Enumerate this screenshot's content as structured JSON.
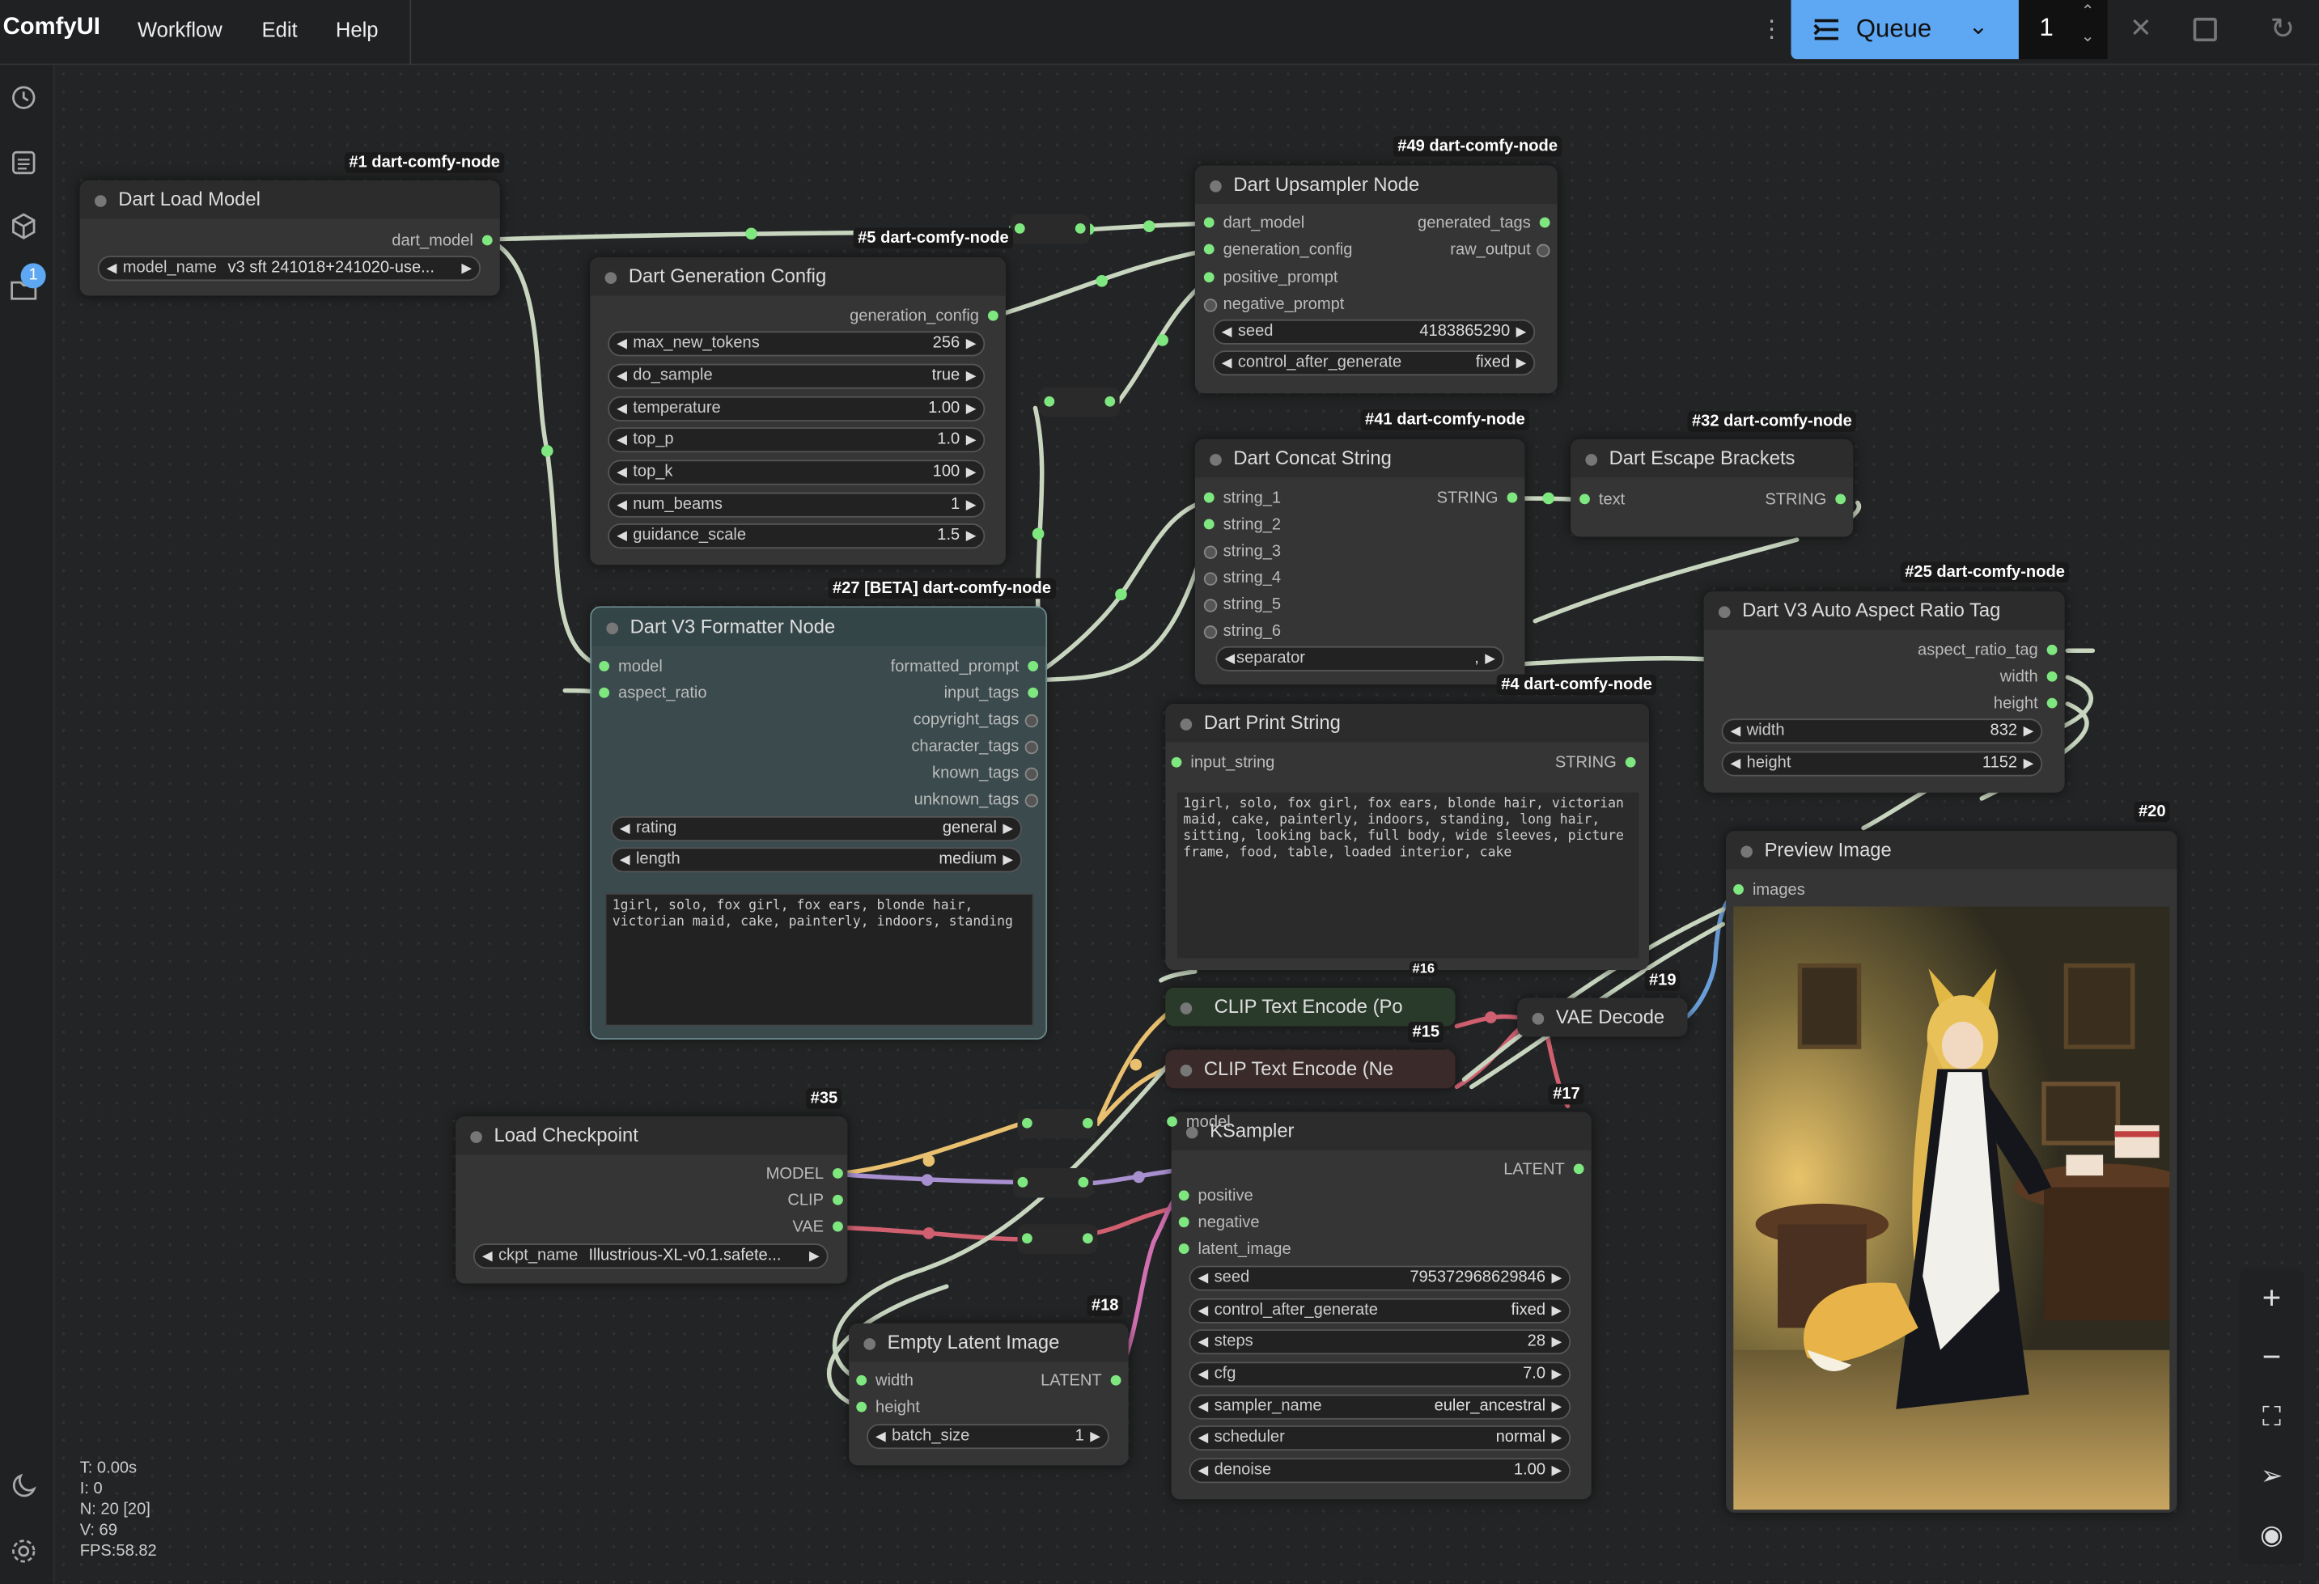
{
  "app": {
    "name": "ComfyUI",
    "menu": [
      "Workflow",
      "Edit",
      "Help"
    ]
  },
  "queue": {
    "label": "Queue",
    "count": "1",
    "notification_count": "1"
  },
  "stats": {
    "t": "T: 0.00s",
    "i": "I: 0",
    "n": "N: 20 [20]",
    "v": "V: 69",
    "fps": "FPS:58.82"
  },
  "nodes": {
    "load_model": {
      "badge": "#1 dart-comfy-node",
      "title": "Dart Load Model",
      "out": "dart_model",
      "w_label": "model_name",
      "w_value": "v3 sft 241018+241020-use..."
    },
    "gen_config": {
      "badge": "#5 dart-comfy-node",
      "title": "Dart Generation Config",
      "out": "generation_config",
      "widgets": [
        [
          "max_new_tokens",
          "256"
        ],
        [
          "do_sample",
          "true"
        ],
        [
          "temperature",
          "1.00"
        ],
        [
          "top_p",
          "1.0"
        ],
        [
          "top_k",
          "100"
        ],
        [
          "num_beams",
          "1"
        ],
        [
          "guidance_scale",
          "1.5"
        ]
      ]
    },
    "upsampler": {
      "badge": "#49 dart-comfy-node",
      "title": "Dart Upsampler Node",
      "in": [
        "dart_model",
        "generation_config",
        "positive_prompt",
        "negative_prompt"
      ],
      "out": [
        "generated_tags",
        "raw_output"
      ],
      "widgets": [
        [
          "seed",
          "4183865290"
        ],
        [
          "control_after_generate",
          "fixed"
        ]
      ]
    },
    "formatter": {
      "badge": "#27 [BETA] dart-comfy-node",
      "title": "Dart V3 Formatter Node",
      "in": [
        "model",
        "aspect_ratio"
      ],
      "out": [
        "formatted_prompt",
        "input_tags",
        "copyright_tags",
        "character_tags",
        "known_tags",
        "unknown_tags"
      ],
      "widgets": [
        [
          "rating",
          "general"
        ],
        [
          "length",
          "medium"
        ]
      ],
      "text": "1girl, solo, fox girl, fox ears, blonde hair, victorian maid, cake, painterly, indoors, standing"
    },
    "concat": {
      "badge": "#41 dart-comfy-node",
      "title": "Dart Concat String",
      "in": [
        "string_1",
        "string_2",
        "string_3",
        "string_4",
        "string_5",
        "string_6"
      ],
      "out": "STRING",
      "w_label": "separator",
      "w_value": ","
    },
    "escape": {
      "badge": "#32 dart-comfy-node",
      "title": "Dart Escape Brackets",
      "in": "text",
      "out": "STRING"
    },
    "aspect": {
      "badge": "#25 dart-comfy-node",
      "title": "Dart V3 Auto Aspect Ratio Tag",
      "out": [
        "aspect_ratio_tag",
        "width",
        "height"
      ],
      "widgets": [
        [
          "width",
          "832"
        ],
        [
          "height",
          "1152"
        ]
      ]
    },
    "print": {
      "badge": "#4 dart-comfy-node",
      "title": "Dart Print String",
      "in": "input_string",
      "out": "STRING",
      "text": "1girl, solo, fox girl, fox ears, blonde hair,  victorian maid, cake, painterly, indoors, standing, long hair, sitting, looking back, full body, wide sleeves, picture frame, food, table, loaded interior, cake"
    },
    "preview": {
      "badge": "#20",
      "title": "Preview Image",
      "in": "images"
    },
    "clip_pos": {
      "badge": "#16",
      "title": "CLIP Text Encode (Po"
    },
    "clip_neg": {
      "badge": "#15",
      "title": "CLIP Text Encode (Ne"
    },
    "vae": {
      "badge": "#19",
      "title": "VAE Decode"
    },
    "checkpoint": {
      "badge": "#35",
      "title": "Load Checkpoint",
      "out": [
        "MODEL",
        "CLIP",
        "VAE"
      ],
      "w_label": "ckpt_name",
      "w_value": "Illustrious-XL-v0.1.safete..."
    },
    "ksampler": {
      "badge": "#17",
      "title": "KSampler",
      "in": [
        "model",
        "positive",
        "negative",
        "latent_image"
      ],
      "out": "LATENT",
      "widgets": [
        [
          "seed",
          "795372968629846"
        ],
        [
          "control_after_generate",
          "fixed"
        ],
        [
          "steps",
          "28"
        ],
        [
          "cfg",
          "7.0"
        ],
        [
          "sampler_name",
          "euler_ancestral"
        ],
        [
          "scheduler",
          "normal"
        ],
        [
          "denoise",
          "1.00"
        ]
      ]
    },
    "latent": {
      "badge": "#18",
      "title": "Empty Latent Image",
      "in": [
        "width",
        "height"
      ],
      "out": "LATENT",
      "w_label": "batch_size",
      "w_value": "1"
    }
  },
  "icons": [
    "history-icon",
    "queue-list-icon",
    "cube-icon",
    "workflow-folder-icon",
    "moon-icon",
    "settings-icon",
    "more-vertical-icon",
    "close-icon",
    "square-icon",
    "refresh-icon",
    "plus-icon",
    "minus-icon",
    "fit-view-icon",
    "send-icon",
    "eye-icon"
  ]
}
